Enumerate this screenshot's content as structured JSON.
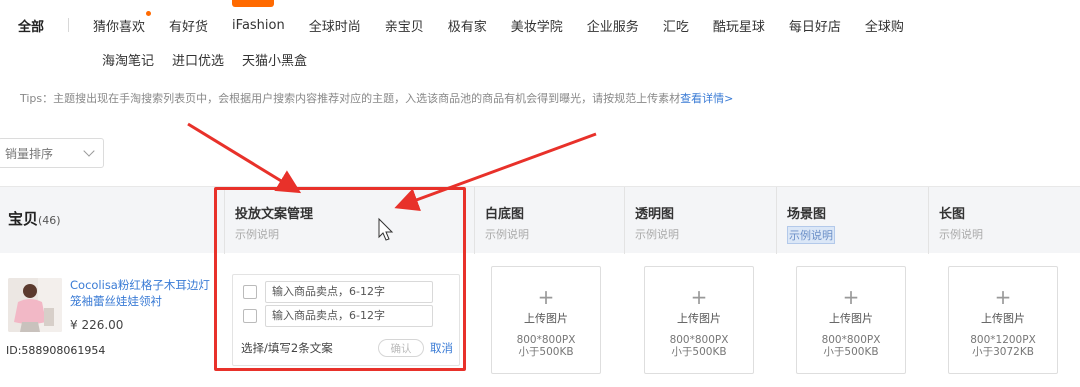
{
  "categories": [
    "全部",
    "猜你喜欢",
    "有好货",
    "iFashion",
    "全球时尚",
    "亲宝贝",
    "极有家",
    "美妆学院",
    "企业服务",
    "汇吃",
    "酷玩星球",
    "每日好店",
    "全球购"
  ],
  "categories_row2": [
    "海淘笔记",
    "进口优选",
    "天猫小黑盒"
  ],
  "tips": {
    "text": "Tips：主题搜出现在手淘搜索列表页中，会根据用户搜索内容推荐对应的主题，入选该商品池的商品有机会得到曝光，请按规范上传素材",
    "link": "查看详情>"
  },
  "sort": {
    "value": "销量排序"
  },
  "table": {
    "baobei_title": "宝贝",
    "baobei_count": "(46)",
    "columns": [
      {
        "title": "投放文案管理",
        "sub": "示例说明"
      },
      {
        "title": "白底图",
        "sub": "示例说明"
      },
      {
        "title": "透明图",
        "sub": "示例说明"
      },
      {
        "title": "场景图",
        "sub": "示例说明"
      },
      {
        "title": "长图",
        "sub": "示例说明"
      }
    ]
  },
  "product": {
    "title": "Cocolisa粉红格子木耳边灯笼袖蕾丝娃娃领衬",
    "price": "¥ 226.00",
    "id": "ID:588908061954"
  },
  "copy": {
    "placeholder1": "输入商品卖点，6-12字",
    "placeholder2": "输入商品卖点，6-12字",
    "footer_label": "选择/填写2条文案",
    "confirm": "确认",
    "cancel": "取消"
  },
  "uploads": [
    {
      "label": "上传图片",
      "spec1": "800*800PX",
      "spec2": "小于500KB"
    },
    {
      "label": "上传图片",
      "spec1": "800*800PX",
      "spec2": "小于500KB"
    },
    {
      "label": "上传图片",
      "spec1": "800*800PX",
      "spec2": "小于500KB"
    },
    {
      "label": "上传图片",
      "spec1": "800*1200PX",
      "spec2": "小于3072KB"
    }
  ],
  "icons": {
    "upload": "plus-icon",
    "dropdown": "chevron-down-icon",
    "cursor": "mouse-pointer-icon"
  },
  "colors": {
    "accent": "#ff6a00",
    "link": "#3a7bd5",
    "annotation": "#e8312a"
  }
}
